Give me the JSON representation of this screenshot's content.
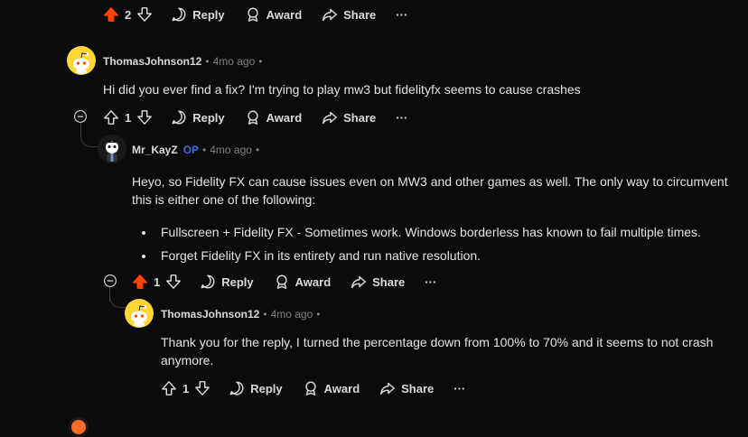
{
  "colors": {
    "upvoted": "#ff4500",
    "op": "#3f6ce6",
    "bg": "#0b0b0c"
  },
  "top_actions": {
    "votes": "2",
    "reply": "Reply",
    "award": "Award",
    "share": "Share",
    "more": "···"
  },
  "comment1": {
    "author": "ThomasJohnson12",
    "time": "4mo ago",
    "body": "Hi did you ever find a fix? I'm trying to play mw3 but fidelityfx seems to cause crashes",
    "votes": "1",
    "reply": "Reply",
    "award": "Award",
    "share": "Share",
    "more": "···"
  },
  "comment2": {
    "author": "Mr_KayZ",
    "op_badge": "OP",
    "time": "4mo ago",
    "body_intro": "Heyo, so Fidelity FX can cause issues even on MW3 and other games as well. The only way to circumvent this is either one of the following:",
    "bullets": [
      "Fullscreen + Fidelity FX - Sometimes work. Windows borderless has known to fail multiple times.",
      "Forget Fidelity FX in its entirety and run native resolution."
    ],
    "votes": "1",
    "reply": "Reply",
    "award": "Award",
    "share": "Share",
    "more": "···"
  },
  "comment3": {
    "author": "ThomasJohnson12",
    "time": "4mo ago",
    "body": "Thank you for the reply, I turned the percentage down from 100% to 70% and it seems to not crash anymore.",
    "votes": "1",
    "reply": "Reply",
    "award": "Award",
    "share": "Share",
    "more": "···"
  }
}
